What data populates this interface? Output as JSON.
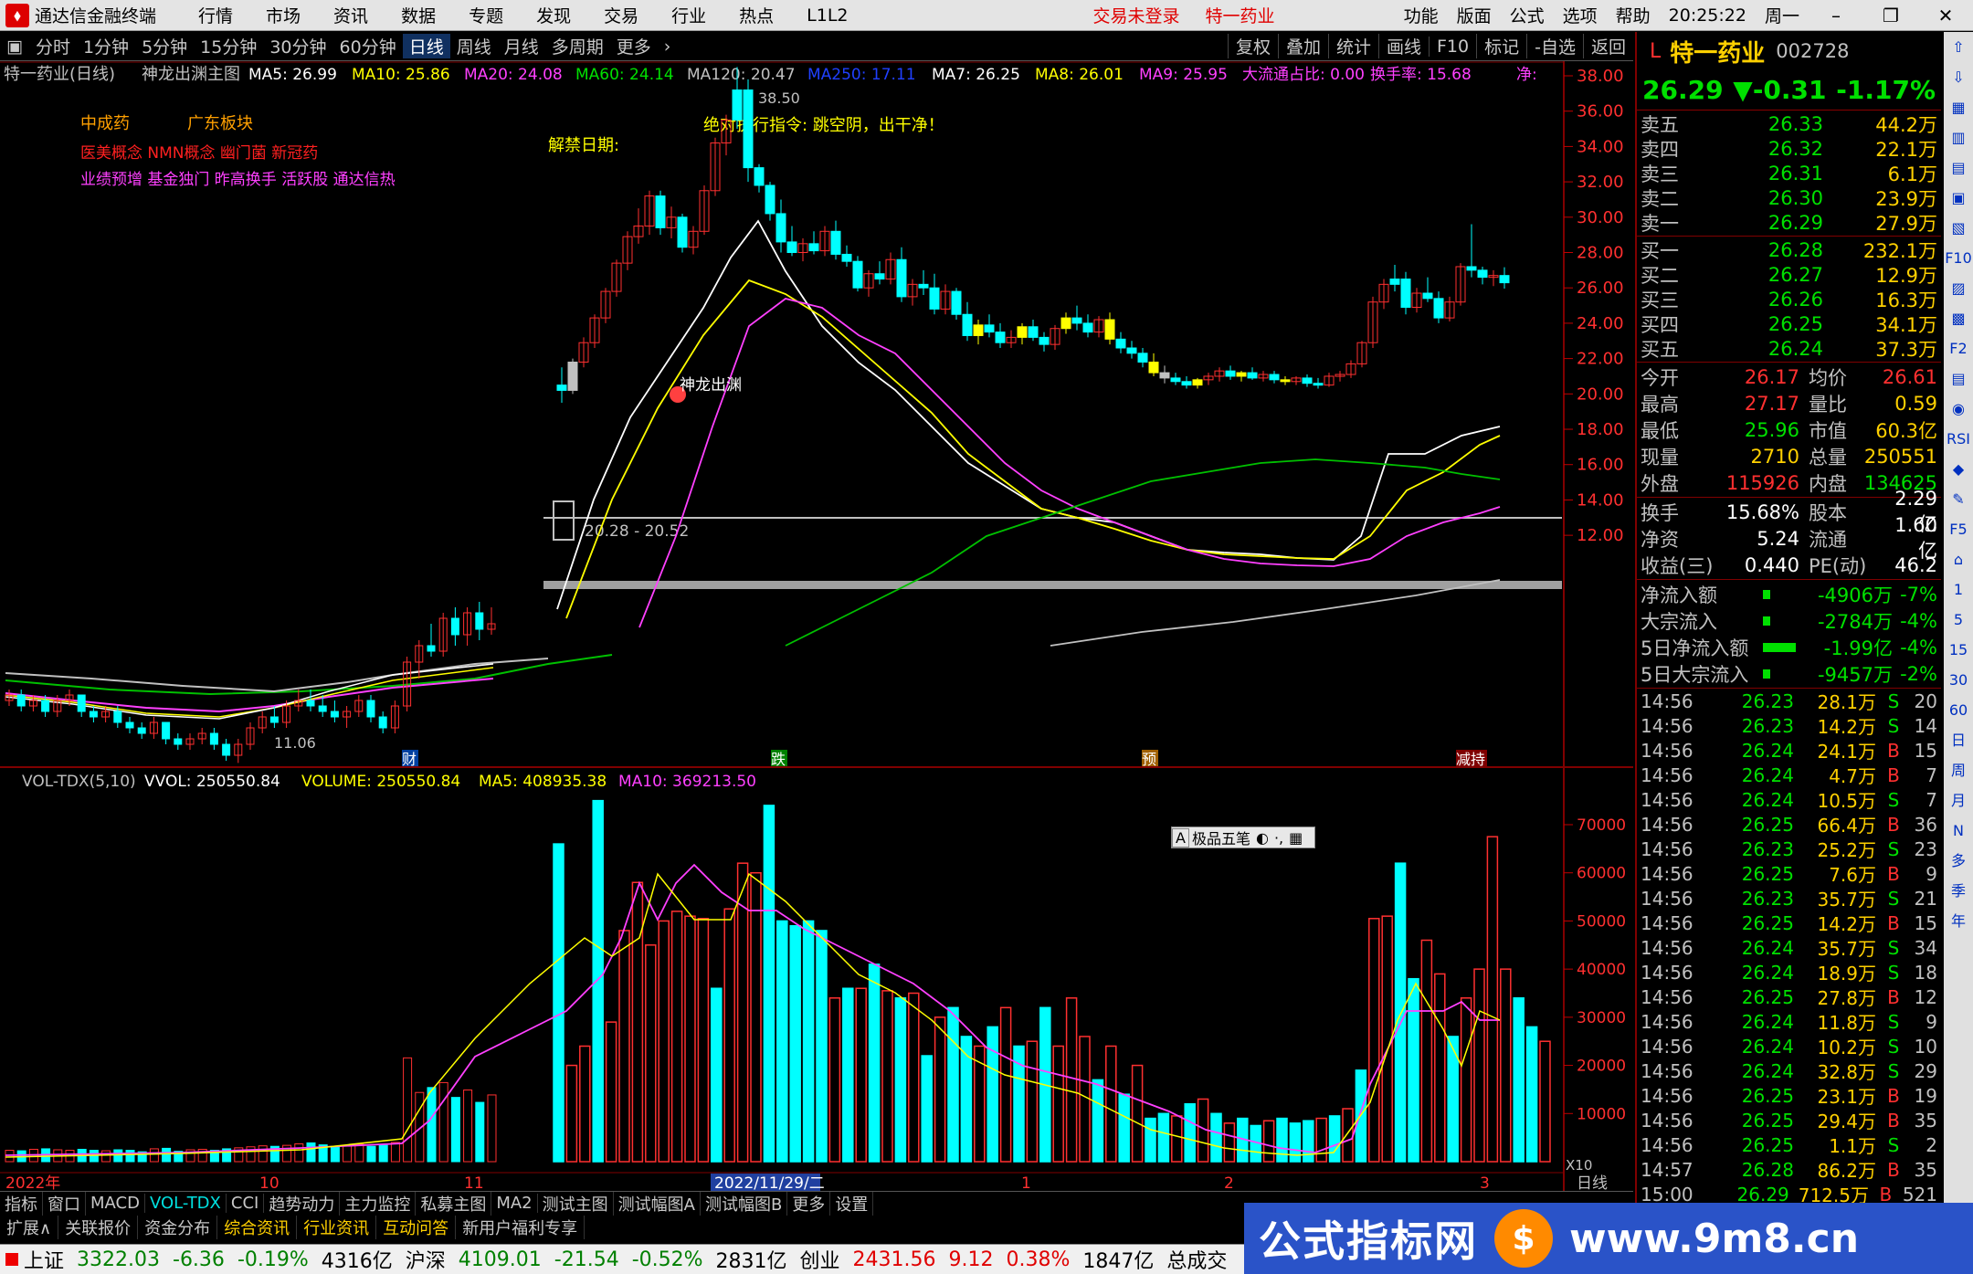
{
  "menubar": {
    "app_title": "通达信金融终端",
    "items": [
      "行情",
      "市场",
      "资讯",
      "数据",
      "专题",
      "发现",
      "交易",
      "行业",
      "热点",
      "L1L2"
    ],
    "status_login": "交易未登录",
    "stock_name": "特一药业",
    "right_items": [
      "功能",
      "版面",
      "公式",
      "选项",
      "帮助"
    ],
    "time": "20:25:22",
    "weekday": "周一"
  },
  "periodbar": {
    "items": [
      "分时",
      "1分钟",
      "5分钟",
      "15分钟",
      "30分钟",
      "60分钟",
      "日线",
      "周线",
      "月线",
      "多周期",
      "更多"
    ],
    "active": "日线",
    "tools": [
      "复权",
      "叠加",
      "统计",
      "画线",
      "F10",
      "标记",
      "-自选",
      "返回"
    ]
  },
  "main_legend": {
    "name": "特一药业(日线)",
    "formula": "神龙出渊主图",
    "ma5": "MA5: 26.99",
    "ma10": "MA10: 25.86",
    "ma20": "MA20: 24.08",
    "ma60": "MA60: 24.14",
    "ma120": "MA120: 20.47",
    "ma250": "MA250: 17.11",
    "ma7": "MA7: 26.25",
    "ma8": "MA8: 26.01",
    "ma9": "MA9: 25.95",
    "dazong": "大流通占比: 0.00",
    "turnover": "换手率: 15.68",
    "jing": "净:"
  },
  "annotations": {
    "concept1": "中成药",
    "concept2": "广东板块",
    "concept_line2": "医美概念 NMN概念 幽门菌 新冠药",
    "concept_line3": "业绩预增 基金独门 昨高换手 活跃股 通达信热",
    "unlock": "解禁日期:",
    "instruction": "绝对执行指令: 跳空阴，出干净！",
    "signal": "神龙出渊",
    "high_label": "38.50",
    "low_label": "11.06",
    "range_label": "20.28 - 20.52",
    "events": [
      "财",
      "跌",
      "预",
      "减持"
    ]
  },
  "vol_legend": {
    "name": "VOL-TDX(5,10)",
    "vvol": "VVOL: 250550.84",
    "volume": "VOLUME: 250550.84",
    "ma5": "MA5: 408935.38",
    "ma10": "MA10: 369213.50",
    "x10": "X10"
  },
  "time_axis": {
    "labels": [
      "2022年",
      "10",
      "11",
      "2022/11/29/二",
      "1",
      "2",
      "3"
    ],
    "period": "日线"
  },
  "price_axis": [
    "38.00",
    "36.00",
    "34.00",
    "32.00",
    "30.00",
    "28.00",
    "26.00",
    "24.00",
    "22.00",
    "20.00",
    "18.00",
    "16.00",
    "14.00",
    "12.00"
  ],
  "vol_axis": [
    "70000",
    "60000",
    "50000",
    "40000",
    "30000",
    "20000",
    "10000"
  ],
  "popup": {
    "label": "极品五笔"
  },
  "quote": {
    "mark": "L",
    "name": "特一药业",
    "code": "002728",
    "price": "26.29",
    "change": "▼-0.31",
    "pct": "-1.17%",
    "asks": [
      {
        "l": "卖五",
        "p": "26.33",
        "v": "44.2万"
      },
      {
        "l": "卖四",
        "p": "26.32",
        "v": "22.1万"
      },
      {
        "l": "卖三",
        "p": "26.31",
        "v": "6.1万"
      },
      {
        "l": "卖二",
        "p": "26.30",
        "v": "23.9万"
      },
      {
        "l": "卖一",
        "p": "26.29",
        "v": "27.9万"
      }
    ],
    "bids": [
      {
        "l": "买一",
        "p": "26.28",
        "v": "232.1万"
      },
      {
        "l": "买二",
        "p": "26.27",
        "v": "12.9万"
      },
      {
        "l": "买三",
        "p": "26.26",
        "v": "16.3万"
      },
      {
        "l": "买四",
        "p": "26.25",
        "v": "34.1万"
      },
      {
        "l": "买五",
        "p": "26.24",
        "v": "37.3万"
      }
    ],
    "stats": [
      [
        "今开",
        "26.17",
        "均价",
        "26.61"
      ],
      [
        "最高",
        "27.17",
        "量比",
        "0.59"
      ],
      [
        "最低",
        "25.96",
        "市值",
        "60.3亿"
      ],
      [
        "现量",
        "2710",
        "总量",
        "250551"
      ],
      [
        "外盘",
        "115926",
        "内盘",
        "134625"
      ]
    ],
    "stats2": [
      [
        "换手",
        "15.68%",
        "股本",
        "2.29亿"
      ],
      [
        "净资",
        "5.24",
        "流通",
        "1.60亿"
      ],
      [
        "收益(三)",
        "0.440",
        "PE(动)",
        "46.2"
      ]
    ],
    "flows": [
      [
        "净流入额",
        "-4906万",
        "-7%"
      ],
      [
        "大宗流入",
        "-2784万",
        "-4%"
      ],
      [
        "5日净流入额",
        "-1.99亿",
        "-4%"
      ],
      [
        "5日大宗流入",
        "-9457万",
        "-2%"
      ]
    ],
    "ticks": [
      [
        "14:56",
        "26.23",
        "28.1万",
        "S",
        "20"
      ],
      [
        "14:56",
        "26.23",
        "14.2万",
        "S",
        "14"
      ],
      [
        "14:56",
        "26.24",
        "24.1万",
        "B",
        "15"
      ],
      [
        "14:56",
        "26.24",
        "4.7万",
        "B",
        "7"
      ],
      [
        "14:56",
        "26.24",
        "10.5万",
        "S",
        "7"
      ],
      [
        "14:56",
        "26.25",
        "66.4万",
        "B",
        "36"
      ],
      [
        "14:56",
        "26.23",
        "25.2万",
        "S",
        "23"
      ],
      [
        "14:56",
        "26.25",
        "7.6万",
        "B",
        "9"
      ],
      [
        "14:56",
        "26.23",
        "35.7万",
        "S",
        "21"
      ],
      [
        "14:56",
        "26.25",
        "14.2万",
        "B",
        "15"
      ],
      [
        "14:56",
        "26.24",
        "35.7万",
        "S",
        "34"
      ],
      [
        "14:56",
        "26.24",
        "18.9万",
        "S",
        "18"
      ],
      [
        "14:56",
        "26.25",
        "27.8万",
        "B",
        "12"
      ],
      [
        "14:56",
        "26.24",
        "11.8万",
        "S",
        "9"
      ],
      [
        "14:56",
        "26.24",
        "10.2万",
        "S",
        "10"
      ],
      [
        "14:56",
        "26.24",
        "32.8万",
        "S",
        "29"
      ],
      [
        "14:56",
        "26.25",
        "23.1万",
        "B",
        "19"
      ],
      [
        "14:56",
        "26.25",
        "29.4万",
        "B",
        "35"
      ],
      [
        "14:56",
        "26.25",
        "1.1万",
        "S",
        "2"
      ],
      [
        "14:57",
        "26.28",
        "86.2万",
        "B",
        "35"
      ],
      [
        "15:00",
        "26.29",
        "712.5万",
        "B",
        "521"
      ]
    ]
  },
  "iconcol": [
    "⇧",
    "⇩",
    "▦",
    "▥",
    "▤",
    "▣",
    "▧",
    "F10",
    "▨",
    "▩",
    "F2",
    "▤",
    "◉",
    "RSI",
    "◆",
    "✎",
    "F5",
    "⌂",
    "1",
    "5",
    "15",
    "30",
    "60",
    "日",
    "周",
    "月",
    "N",
    "多",
    "季",
    "年"
  ],
  "tabs1": [
    "指标",
    "窗口",
    "MACD",
    "VOL-TDX",
    "CCI",
    "趋势动力",
    "主力监控",
    "私募主图",
    "MA2",
    "测试主图",
    "测试幅图A",
    "测试幅图B",
    "更多",
    "设置"
  ],
  "tabs1_active": "VOL-TDX",
  "tabs2": [
    "扩展∧",
    "关联报价",
    "资金分布",
    "综合资讯",
    "行业资讯",
    "互动问答",
    "新用户福利专享"
  ],
  "status": {
    "sh_name": "上证",
    "sh_val": "3322.03",
    "sh_chg": "-6.36",
    "sh_pct": "-0.19%",
    "sh_amt": "4316亿",
    "sz_name": "沪深",
    "sz_val": "4109.01",
    "sz_chg": "-21.54",
    "sz_pct": "-0.52%",
    "sz_amt": "2831亿",
    "cy_name": "创业",
    "cy_val": "2431.56",
    "cy_chg": "9.12",
    "cy_pct": "0.38%",
    "cy_amt": "1847亿",
    "total": "总成交"
  },
  "watermark": {
    "text": "公式指标网",
    "url": "www.9m8.cn"
  },
  "colors": {
    "up": "#ff3030",
    "down": "#00ffff",
    "ma5": "#ffffff",
    "ma10": "#ffff00",
    "ma20": "#ff00ff",
    "ma60": "#00c000",
    "ma120": "#c0c0c0"
  },
  "chart_data": {
    "type": "candlestick",
    "price_range": [
      11,
      38.5
    ],
    "vol_range": [
      0,
      75000
    ],
    "candles": [
      [
        12.2,
        12.4,
        12.1,
        12.3,
        2300
      ],
      [
        12.3,
        12.4,
        12.0,
        12.1,
        2200
      ],
      [
        12.1,
        12.3,
        12.0,
        12.2,
        2500
      ],
      [
        12.2,
        12.3,
        11.9,
        12.0,
        2600
      ],
      [
        12.0,
        12.3,
        11.9,
        12.2,
        2400
      ],
      [
        12.2,
        12.4,
        12.1,
        12.3,
        2300
      ],
      [
        12.3,
        12.3,
        11.9,
        12.0,
        2500
      ],
      [
        12.0,
        12.1,
        11.8,
        11.9,
        2300
      ],
      [
        11.9,
        12.1,
        11.8,
        12.0,
        2200
      ],
      [
        12.0,
        12.1,
        11.7,
        11.8,
        2400
      ],
      [
        11.8,
        11.9,
        11.6,
        11.7,
        2300
      ],
      [
        11.7,
        11.8,
        11.5,
        11.6,
        2000
      ],
      [
        11.6,
        11.9,
        11.5,
        11.8,
        2600
      ],
      [
        11.8,
        11.8,
        11.4,
        11.5,
        2700
      ],
      [
        11.5,
        11.6,
        11.3,
        11.4,
        2100
      ],
      [
        11.4,
        11.6,
        11.3,
        11.5,
        2400
      ],
      [
        11.5,
        11.7,
        11.4,
        11.6,
        2500
      ],
      [
        11.6,
        11.7,
        11.3,
        11.4,
        2300
      ],
      [
        11.4,
        11.5,
        11.1,
        11.2,
        2600
      ],
      [
        11.2,
        11.5,
        11.06,
        11.4,
        2800
      ],
      [
        11.4,
        11.8,
        11.3,
        11.7,
        3000
      ],
      [
        11.7,
        12.0,
        11.6,
        11.9,
        3200
      ],
      [
        11.9,
        12.1,
        11.7,
        11.8,
        3100
      ],
      [
        11.8,
        12.2,
        11.7,
        12.1,
        3300
      ],
      [
        12.1,
        12.4,
        12.0,
        12.2,
        3600
      ],
      [
        12.2,
        12.4,
        12.0,
        12.1,
        3800
      ],
      [
        12.1,
        12.3,
        11.9,
        12.0,
        3400
      ],
      [
        12.0,
        12.2,
        11.8,
        11.9,
        3000
      ],
      [
        11.9,
        12.1,
        11.7,
        12.0,
        3200
      ],
      [
        12.0,
        12.3,
        11.9,
        12.2,
        3500
      ],
      [
        12.2,
        12.3,
        11.8,
        11.9,
        3100
      ],
      [
        11.9,
        12.0,
        11.6,
        11.7,
        3300
      ],
      [
        11.7,
        12.2,
        11.6,
        12.1,
        3900
      ],
      [
        12.1,
        13.0,
        12.0,
        12.9,
        21000
      ],
      [
        12.9,
        13.3,
        12.6,
        13.2,
        14000
      ],
      [
        13.2,
        13.6,
        13.0,
        13.1,
        15000
      ],
      [
        13.1,
        13.8,
        13.0,
        13.7,
        16000
      ],
      [
        13.7,
        13.9,
        13.2,
        13.4,
        13000
      ],
      [
        13.4,
        13.9,
        13.2,
        13.8,
        14500
      ],
      [
        13.8,
        14.0,
        13.3,
        13.5,
        12000
      ],
      [
        13.5,
        13.9,
        13.4,
        13.6,
        13500
      ]
    ]
  }
}
